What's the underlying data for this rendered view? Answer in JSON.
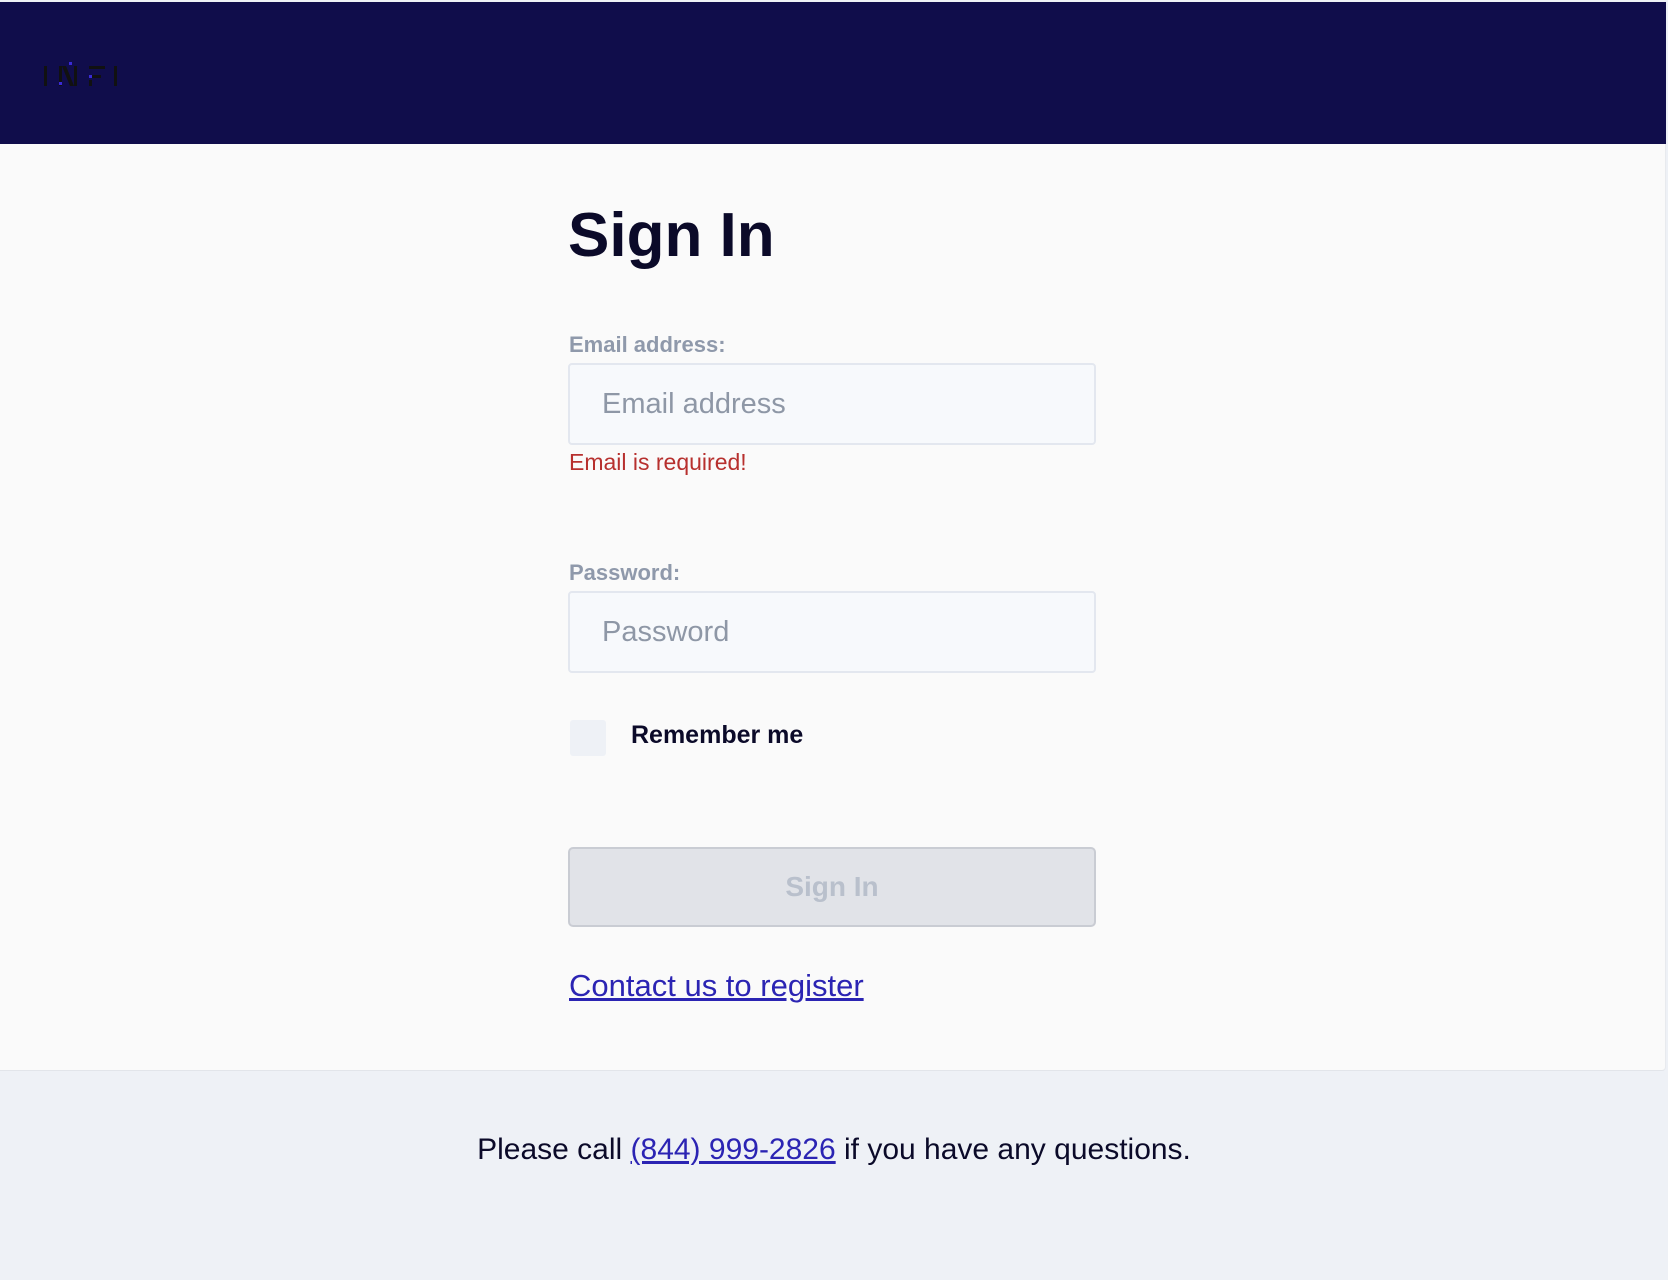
{
  "header": {
    "logo_alt": "INFI"
  },
  "signin": {
    "title": "Sign In",
    "email": {
      "label": "Email address:",
      "placeholder": "Email address",
      "value": "",
      "error": "Email is required!"
    },
    "password": {
      "label": "Password:",
      "placeholder": "Password",
      "value": ""
    },
    "remember": {
      "label": "Remember me",
      "checked": false
    },
    "submit_label": "Sign In",
    "register_link": "Contact us to register"
  },
  "footer": {
    "prefix": "Please call ",
    "phone": "(844) 999-2826",
    "suffix": " if you have any questions."
  },
  "colors": {
    "header_bg": "#100d4b",
    "accent": "#2b24b3",
    "error": "#b7302e"
  }
}
